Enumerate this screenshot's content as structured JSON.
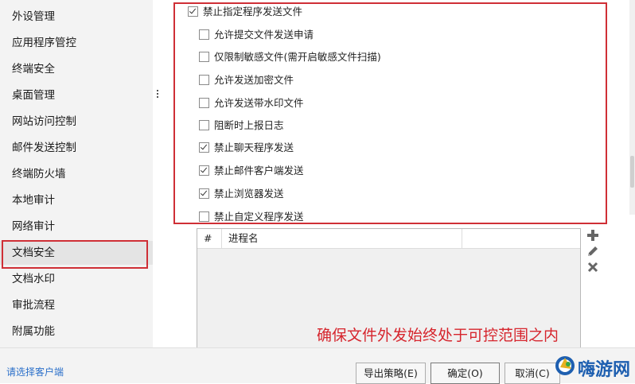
{
  "sidebar": {
    "items": [
      {
        "label": "外设管理"
      },
      {
        "label": "应用程序管控"
      },
      {
        "label": "终端安全"
      },
      {
        "label": "桌面管理"
      },
      {
        "label": "网站访问控制"
      },
      {
        "label": "邮件发送控制"
      },
      {
        "label": "终端防火墙"
      },
      {
        "label": "本地审计"
      },
      {
        "label": "网络审计"
      },
      {
        "label": "文档安全",
        "active": true
      },
      {
        "label": "文档水印"
      },
      {
        "label": "审批流程"
      },
      {
        "label": "附属功能"
      }
    ],
    "footer_link": "请选择客户端"
  },
  "options": {
    "main": {
      "label": "禁止指定程序发送文件",
      "checked": true
    },
    "sub": [
      {
        "label": "允许提交文件发送申请",
        "checked": false
      },
      {
        "label": "仅限制敏感文件(需开启敏感文件扫描)",
        "checked": false
      },
      {
        "label": "允许发送加密文件",
        "checked": false
      },
      {
        "label": "允许发送带水印文件",
        "checked": false
      },
      {
        "label": "阻断时上报日志",
        "checked": false
      },
      {
        "label": "禁止聊天程序发送",
        "checked": true
      },
      {
        "label": "禁止邮件客户端发送",
        "checked": true
      },
      {
        "label": "禁止浏览器发送",
        "checked": true
      },
      {
        "label": "禁止自定义程序发送",
        "checked": false
      }
    ]
  },
  "table": {
    "columns": [
      "#",
      "进程名"
    ]
  },
  "annotation": "确保文件外发始终处于可控范围之内",
  "buttons": {
    "export": "导出策略(E)",
    "ok": "确定(O)",
    "cancel": "取消(C)"
  },
  "watermark": {
    "text": "嗨游网"
  },
  "colors": {
    "highlight": "#cf2f36",
    "annotation": "#d6252d",
    "link": "#2a6fc9"
  }
}
